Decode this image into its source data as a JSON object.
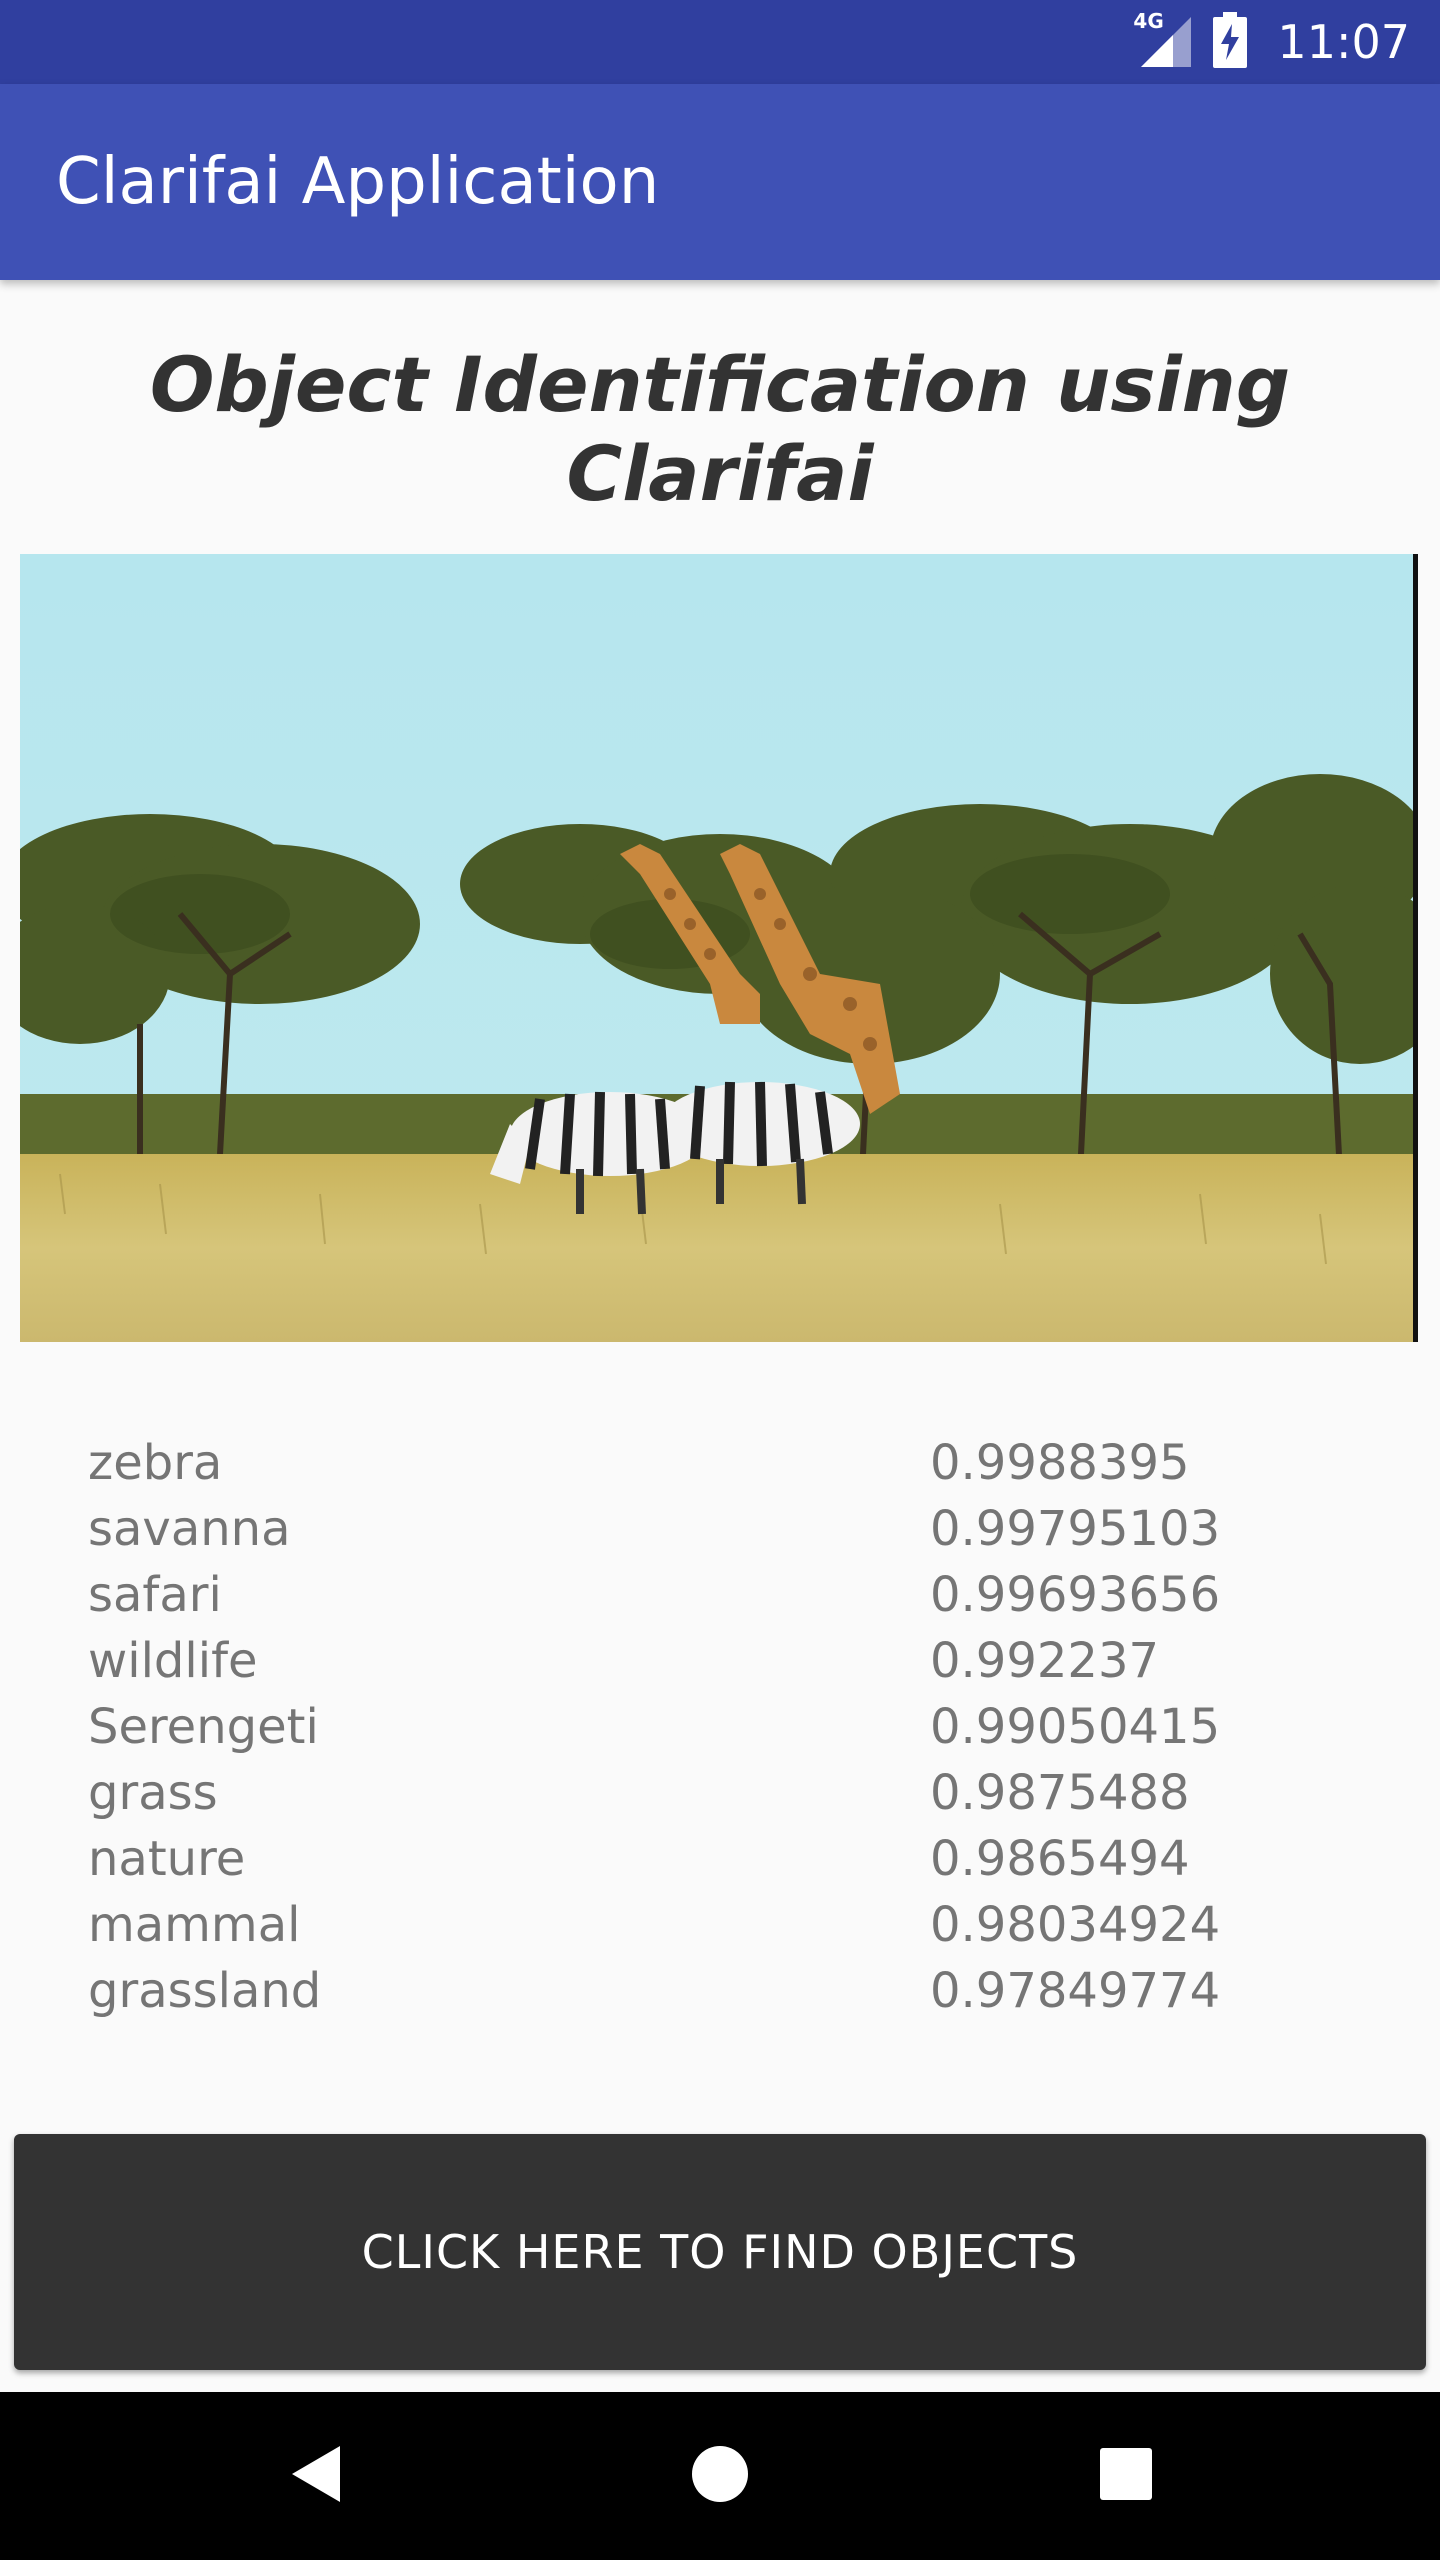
{
  "status_bar": {
    "network_label": "4G",
    "time": "11:07"
  },
  "app_bar": {
    "title": "Clarifai Application"
  },
  "main": {
    "heading": "Object Identification using Clarifai",
    "results": [
      {
        "name": "zebra",
        "score": "0.9988395"
      },
      {
        "name": "savanna",
        "score": "0.99795103"
      },
      {
        "name": "safari",
        "score": "0.99693656"
      },
      {
        "name": "wildlife",
        "score": "0.992237"
      },
      {
        "name": "Serengeti",
        "score": "0.99050415"
      },
      {
        "name": "grass",
        "score": "0.9875488"
      },
      {
        "name": "nature",
        "score": "0.9865494"
      },
      {
        "name": "mammal",
        "score": "0.98034924"
      },
      {
        "name": "grassland",
        "score": "0.97849774"
      }
    ],
    "button_label": "CLICK HERE TO FIND OBJECTS"
  },
  "nav_bar": {
    "back": "back-icon",
    "home": "home-icon",
    "recents": "recents-icon"
  },
  "colors": {
    "status_bar": "#303f9f",
    "app_bar": "#3f51b5",
    "button": "#333333"
  }
}
